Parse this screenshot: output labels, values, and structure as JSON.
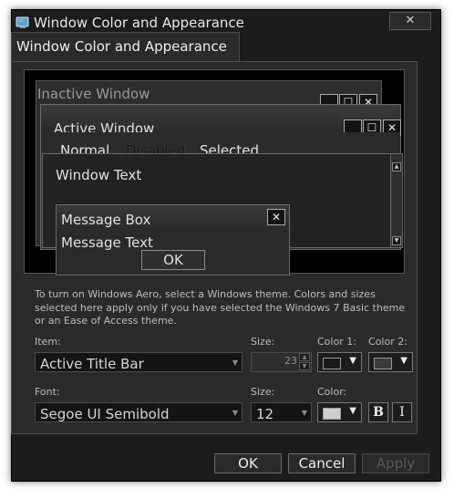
{
  "window": {
    "title": "Window Color and Appearance",
    "close_glyph": "✕"
  },
  "tab": {
    "label": "Window Color and Appearance"
  },
  "preview": {
    "inactive_title": "Inactive Window",
    "active_title": "Active Window",
    "menu": {
      "normal": "Normal",
      "disabled": "Disabled",
      "selected": "Selected"
    },
    "window_text": "Window Text",
    "message_box": {
      "title": "Message Box",
      "text": "Message Text",
      "ok": "OK"
    },
    "caption_glyphs": {
      "minimize": "_",
      "maximize": "☐",
      "close": "✕"
    }
  },
  "description": "To turn on Windows Aero, select a Windows theme.  Colors and sizes selected here apply only if you have selected the Windows 7 Basic theme or an Ease of Access theme.",
  "item": {
    "label": "Item:",
    "value": "Active Title Bar"
  },
  "item_size": {
    "label": "Size:",
    "value": "23"
  },
  "color1": {
    "label": "Color 1:",
    "value": "#1a1a1a"
  },
  "color2": {
    "label": "Color 2:",
    "value": "#3a3a3a"
  },
  "font": {
    "label": "Font:",
    "value": "Segoe UI Semibold"
  },
  "font_size": {
    "label": "Size:",
    "value": "12"
  },
  "font_color": {
    "label": "Color:",
    "value": "#cfcfcf"
  },
  "bold_label": "B",
  "italic_label": "I",
  "buttons": {
    "ok": "OK",
    "cancel": "Cancel",
    "apply": "Apply"
  }
}
